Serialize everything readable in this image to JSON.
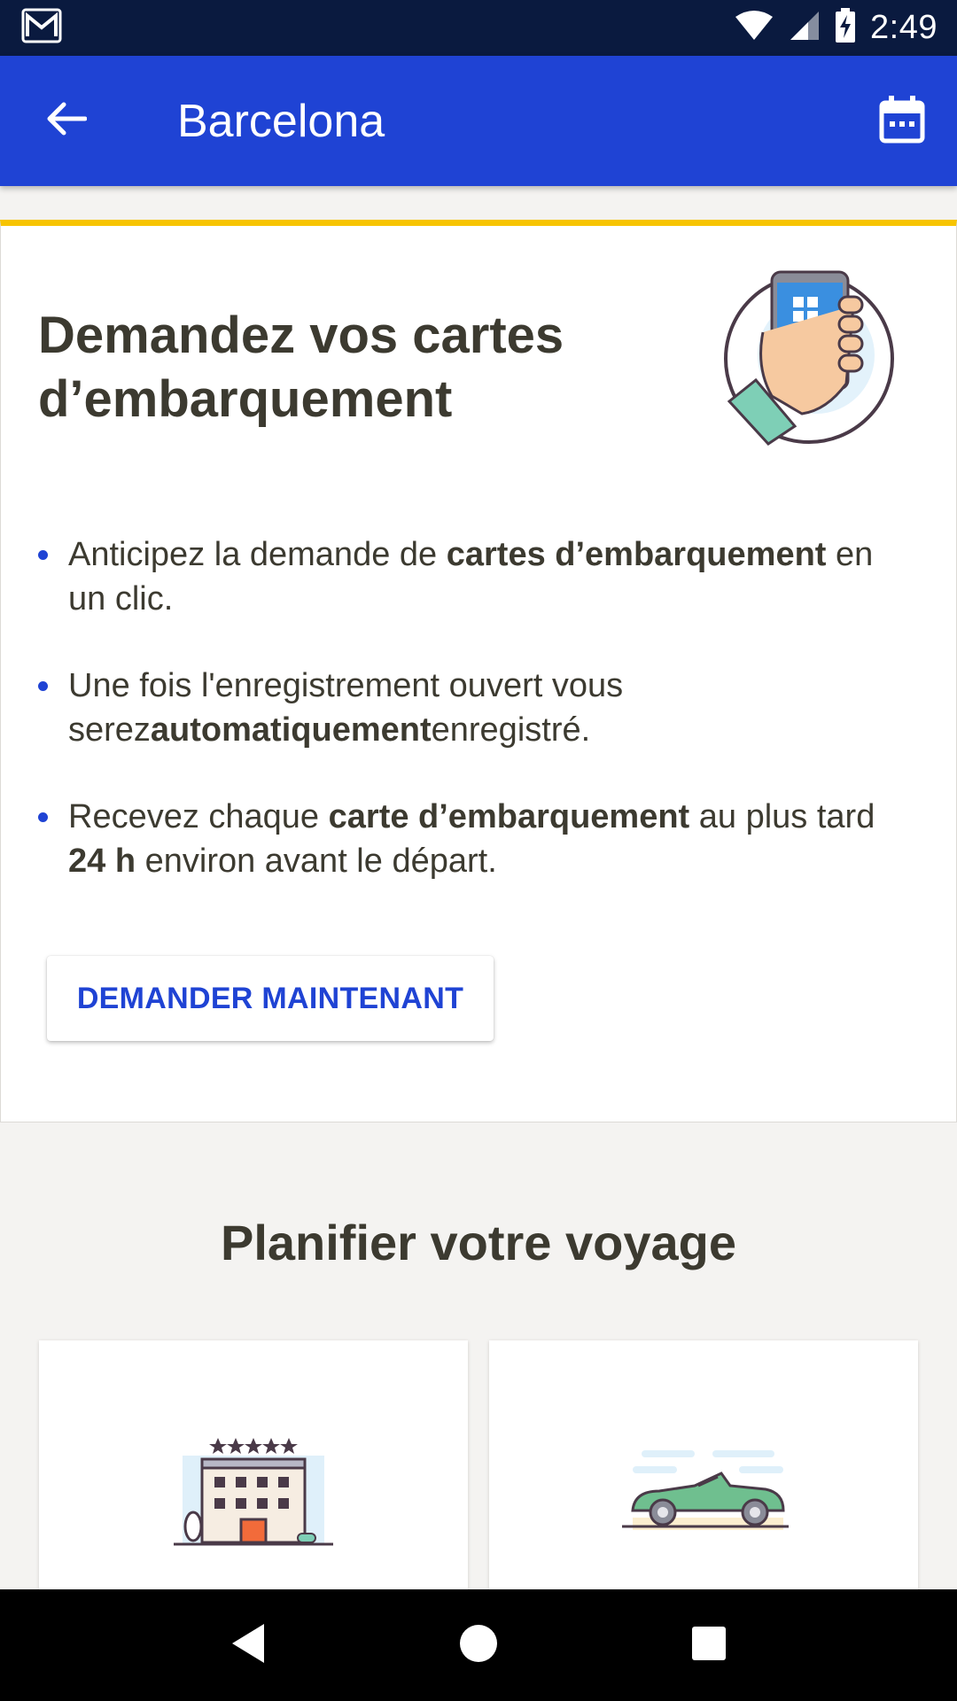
{
  "status_bar": {
    "time": "2:49",
    "icons": [
      "gmail-icon",
      "wifi-icon",
      "cell-signal-icon",
      "battery-charging-icon"
    ]
  },
  "app_bar": {
    "title": "Barcelona",
    "back_icon": "arrow-back-icon",
    "calendar_icon": "calendar-icon",
    "color": "#1f43d4"
  },
  "boarding_card": {
    "title": "Demandez vos cartes d’embarquement",
    "accent_color": "#f7c400",
    "illustration": "phone-qr-illustration",
    "bullets": [
      {
        "before": "Anticipez la demande de ",
        "bold": "cartes d’embarquement",
        "after": " en un clic."
      },
      {
        "before": "Une fois l'enregistrement ouvert vous serez",
        "bold": "automatiquement",
        "after": "enregistré."
      },
      {
        "before": "Recevez chaque ",
        "bold": "carte d’embarquement",
        "middle": " au plus tard ",
        "bold2": "24 h",
        "after": " environ avant le départ."
      }
    ],
    "button_label": "DEMANDER MAINTENANT"
  },
  "plan": {
    "title": "Planifier votre voyage",
    "cards": [
      {
        "icon": "hotel-icon"
      },
      {
        "icon": "car-icon"
      }
    ]
  },
  "nav_bar": {
    "buttons": [
      "back-triangle-icon",
      "home-circle-icon",
      "recents-square-icon"
    ]
  }
}
